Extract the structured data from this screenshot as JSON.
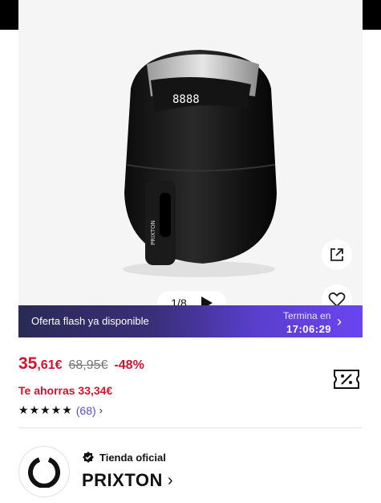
{
  "gallery": {
    "pager_text": "1/8",
    "icons": {
      "share": "external-link-icon",
      "like": "heart-icon",
      "play": "play-icon"
    }
  },
  "flash": {
    "label": "Oferta flash ya disponible",
    "ends_label": "Termina en",
    "timer": "17:06:29"
  },
  "price": {
    "main_int": "35",
    "main_dec": ",61€",
    "old": "68,95€",
    "discount": "-48%",
    "savings": "Te ahorras 33,34€"
  },
  "rating": {
    "stars": "★★★★★",
    "reviews": "(68)",
    "chevron": "›"
  },
  "store": {
    "official_label": "Tienda oficial",
    "name": "PRIXTON",
    "chevron": "›"
  },
  "colors": {
    "price_red": "#d0132f",
    "accent_purple": "#5a3fd0",
    "review_link": "#5a4bd1"
  }
}
